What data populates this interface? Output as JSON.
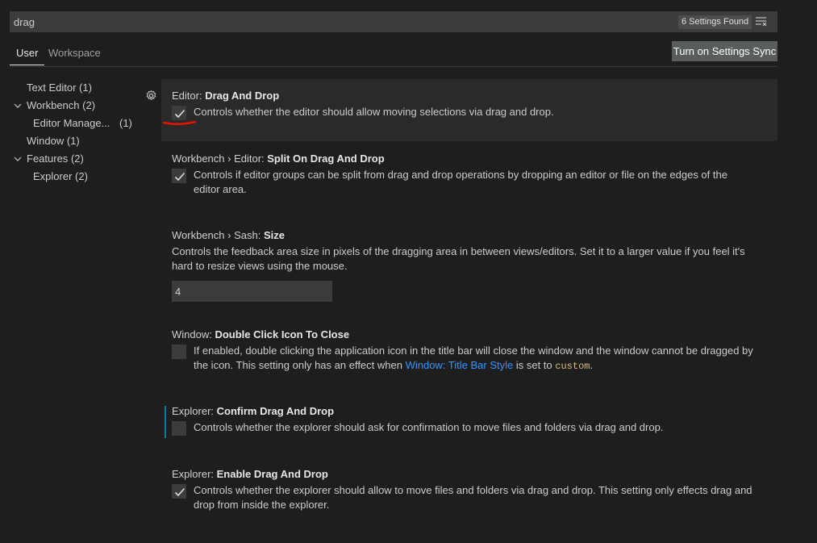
{
  "search": {
    "value": "drag",
    "count_label": "6 Settings Found",
    "filter_icon": "clear-filter-icon"
  },
  "tabs": [
    {
      "label": "User",
      "active": true
    },
    {
      "label": "Workspace",
      "active": false
    }
  ],
  "sync_button": {
    "label": "Turn on Settings Sync"
  },
  "toc": [
    {
      "label": "Text Editor",
      "count": "(1)",
      "expandable": false
    },
    {
      "label": "Workbench",
      "count": "(2)",
      "expandable": true
    },
    {
      "label": "Editor Manage...",
      "count": "(1)",
      "expandable": false
    },
    {
      "label": "Window",
      "count": "(1)",
      "expandable": false
    },
    {
      "label": "Features",
      "count": "(2)",
      "expandable": true
    },
    {
      "label": "Explorer",
      "count": "(2)",
      "expandable": false
    }
  ],
  "settings": [
    {
      "category": "Editor: ",
      "key": "Drag And Drop",
      "checked": true,
      "desc": "Controls whether the editor should allow moving selections via drag and drop."
    },
    {
      "category": "Workbench",
      "category2": " › Editor: ",
      "key": "Split On Drag And Drop",
      "checked": true,
      "desc1": "Controls if editor groups can be split from drag and drop operations by dropping an editor or file on the edges of the",
      "desc2": "editor area."
    },
    {
      "category": "Workbench",
      "category2": " › Sash: ",
      "key": "Size",
      "desc1": "Controls the feedback area size in pixels of the dragging area in between views/editors. Set it to a larger value if you feel it's",
      "desc2": "hard to resize views using the mouse.",
      "value": "4"
    },
    {
      "category": "Window: ",
      "key": "Double Click Icon To Close",
      "checked": false,
      "desc1": "If enabled, double clicking the application icon in the title bar will close the window and the window cannot be dragged by",
      "desc2_pre": "the icon. This setting only has an effect when ",
      "desc2_link": "Window: Title Bar Style",
      "desc2_mid": " is set to ",
      "desc2_code": "custom",
      "desc2_end": "."
    },
    {
      "category": "Explorer: ",
      "key": "Confirm Drag And Drop",
      "checked": false,
      "desc": "Controls whether the explorer should ask for confirmation to move files and folders via drag and drop."
    },
    {
      "category": "Explorer: ",
      "key": "Enable Drag And Drop",
      "checked": true,
      "desc1": "Controls whether the explorer should allow to move files and folders via drag and drop. This setting only effects drag and",
      "desc2": "drop from inside the explorer."
    }
  ],
  "colors": {
    "background": "#1e1e1e",
    "input": "#3c3c3c",
    "link": "#3794ff",
    "modified": "#0c7d9d",
    "annotation": "#e51400"
  }
}
